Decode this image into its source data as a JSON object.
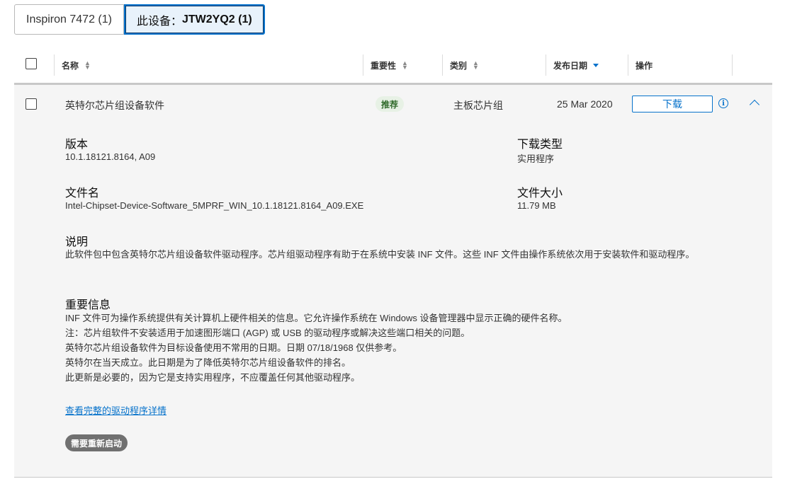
{
  "tabs": [
    {
      "label_plain": "Inspiron 7472 (1)"
    },
    {
      "label_prefix": "此设备：",
      "label_bold": "JTW2YQ2 (1)"
    }
  ],
  "table_header": {
    "name": "名称",
    "importance": "重要性",
    "category": "类别",
    "release_date": "发布日期",
    "action": "操作"
  },
  "driver": {
    "name": "英特尔芯片组设备软件",
    "importance": "推荐",
    "category": "主板芯片组",
    "release_date": "25 Mar 2020",
    "download_label": "下载",
    "version_label": "版本",
    "version_value": "10.1.18121.8164, A09",
    "download_type_label": "下载类型",
    "download_type_value": "实用程序",
    "file_name_label": "文件名",
    "file_name_value": "Intel-Chipset-Device-Software_5MPRF_WIN_10.1.18121.8164_A09.EXE",
    "file_size_label": "文件大小",
    "file_size_value": "11.79 MB",
    "description_label": "说明",
    "description_value": "此软件包中包含英特尔芯片组设备软件驱动程序。芯片组驱动程序有助于在系统中安装 INF 文件。这些 INF 文件由操作系统依次用于安装软件和驱动程序。",
    "important_label": "重要信息",
    "important_lines": [
      "INF 文件可为操作系统提供有关计算机上硬件相关的信息。它允许操作系统在 Windows 设备管理器中显示正确的硬件名称。",
      "注：芯片组软件不安装适用于加速图形端口 (AGP) 或 USB 的驱动程序或解决这些端口相关的问题。",
      "英特尔芯片组设备软件为目标设备使用不常用的日期。日期 07/18/1968 仅供参考。",
      "英特尔在当天成立。此日期是为了降低英特尔芯片组设备软件的排名。",
      "此更新是必要的，因为它是支持实用程序，不应覆盖任何其他驱动程序。"
    ],
    "details_link": "查看完整的驱动程序详情",
    "restart_badge": "需要重新启动"
  },
  "colors": {
    "accent": "#0672cb",
    "panel_bg": "#f5f5f5",
    "recommended_bg": "#e7f1e5",
    "recommended_text": "#2f6a2a",
    "restart_bg": "#707070"
  },
  "icons": {
    "sort_both": "sort-icon",
    "sort_desc": "sort-desc-icon",
    "info": "info-icon",
    "collapse": "chevron-up-icon"
  }
}
